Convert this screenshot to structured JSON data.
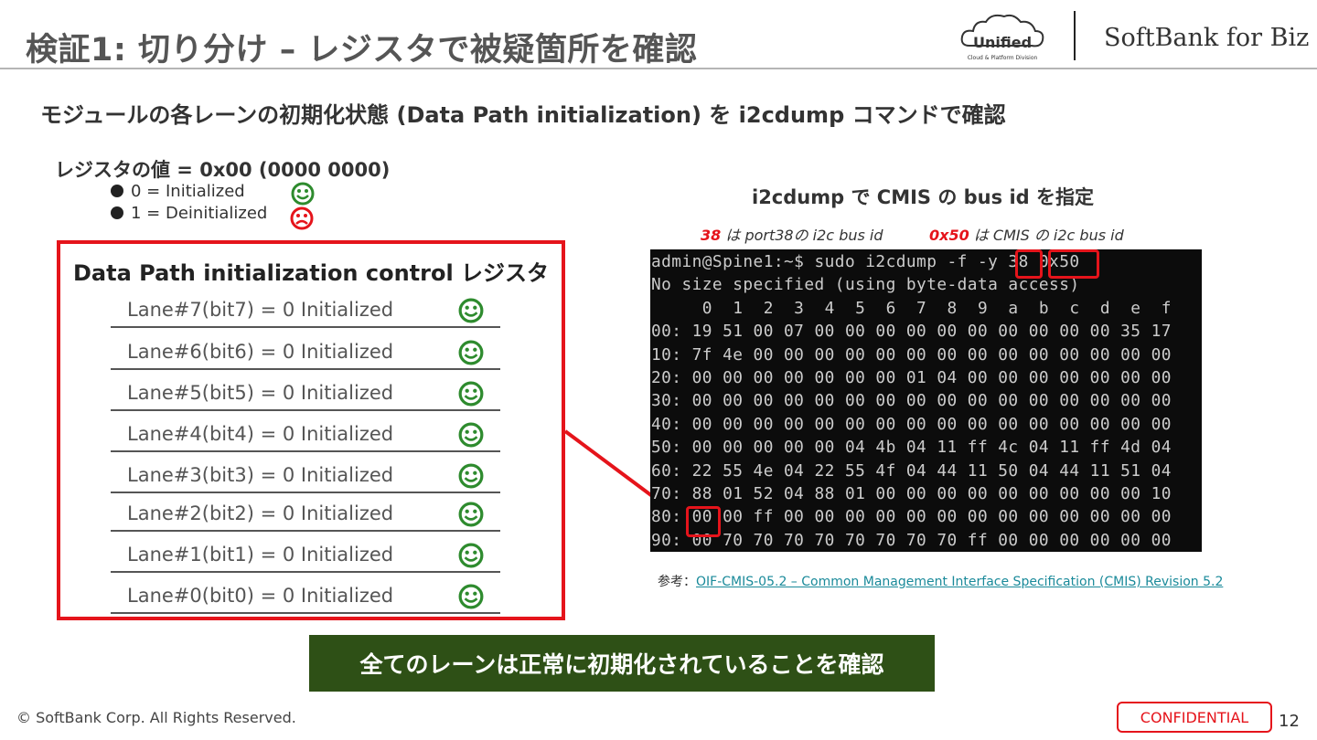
{
  "header": {
    "title": "検証1: 切り分け – レジスタで被疑箇所を確認",
    "logo_unified": "Unified",
    "logo_unified_sub": "Cloud & Platform Division",
    "logo_softbank": "SoftBank for Biz"
  },
  "subtitle": "モジュールの各レーンの初期化状態 (Data Path initialization) を i2cdump コマンドで確認",
  "register": {
    "value_label": "レジスタの値 = 0x00 (0000 0000)",
    "legend": [
      {
        "text": "0 = Initialized",
        "face": "smile-icon"
      },
      {
        "text": "1 = Deinitialized",
        "face": "frown-icon"
      }
    ]
  },
  "lanes_box": {
    "title": "Data Path initialization control レジスタ",
    "lanes": [
      "Lane#7(bit7) = 0 Initialized",
      "Lane#6(bit6) = 0 Initialized",
      "Lane#5(bit5) = 0 Initialized",
      "Lane#4(bit4) = 0 Initialized",
      "Lane#3(bit3) = 0 Initialized",
      "Lane#2(bit2) = 0 Initialized",
      "Lane#1(bit1) = 0 Initialized",
      "Lane#0(bit0) = 0 Initialized"
    ]
  },
  "cmis": {
    "title": "i2cdump で CMIS の bus id を指定",
    "note_bus_value": "38",
    "note_bus_text": " は port38の i2c bus id",
    "note_addr_value": "0x50",
    "note_addr_text": " は CMIS の i2c bus id"
  },
  "terminal": {
    "lines": [
      "admin@Spine1:~$ sudo i2cdump -f -y 38 0x50",
      "No size specified (using byte-data access)",
      "     0  1  2  3  4  5  6  7  8  9  a  b  c  d  e  f",
      "00: 19 51 00 07 00 00 00 00 00 00 00 00 00 00 35 17",
      "10: 7f 4e 00 00 00 00 00 00 00 00 00 00 00 00 00 00",
      "20: 00 00 00 00 00 00 00 01 04 00 00 00 00 00 00 00",
      "30: 00 00 00 00 00 00 00 00 00 00 00 00 00 00 00 00",
      "40: 00 00 00 00 00 00 00 00 00 00 00 00 00 00 00 00",
      "50: 00 00 00 00 00 04 4b 04 11 ff 4c 04 11 ff 4d 04",
      "60: 22 55 4e 04 22 55 4f 04 44 11 50 04 44 11 51 04",
      "70: 88 01 52 04 88 01 00 00 00 00 00 00 00 00 00 10",
      "80: 00 00 ff 00 00 00 00 00 00 00 00 00 00 00 00 00",
      "90: 00 70 70 70 70 70 70 70 70 ff 00 00 00 00 00 00"
    ]
  },
  "reference": {
    "prefix": "参考：",
    "link_text": "OIF-CMIS-05.2 – Common Management Interface Specification (CMIS) Revision 5.2"
  },
  "conclusion": "全てのレーンは正常に初期化されていることを確認",
  "footer": {
    "copyright": "© SoftBank Corp. All Rights Reserved.",
    "confidential": "CONFIDENTIAL",
    "page_number": "12"
  },
  "colors": {
    "accent_red": "#e5141b",
    "smile_green": "#2e8b2e",
    "frown_red": "#e5141b",
    "conclusion_bg": "#2e5016",
    "terminal_bg": "#0c0c0c",
    "link": "#1a8a9a"
  }
}
